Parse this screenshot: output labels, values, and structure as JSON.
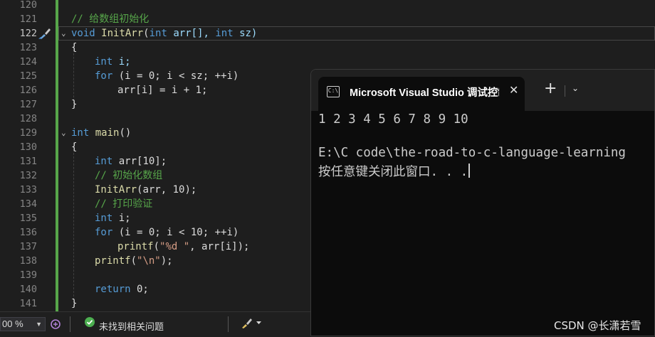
{
  "editor": {
    "line_numbers": [
      "120",
      "121",
      "122",
      "123",
      "124",
      "125",
      "126",
      "127",
      "128",
      "129",
      "130",
      "131",
      "132",
      "133",
      "134",
      "135",
      "136",
      "137",
      "138",
      "139",
      "140",
      "141"
    ],
    "active_line": "122"
  },
  "code": {
    "l121": "// 给数组初始化",
    "l122_kw": "void",
    "l122_fn": "InitArr",
    "l122_p1": "(",
    "l122_kw2": "int",
    "l122_p2": " arr[], ",
    "l122_kw3": "int",
    "l122_p3": " sz)",
    "l123": "{",
    "l124_kw": "int",
    "l124_rest": " i;",
    "l125_kw": "for",
    "l125_rest": " (i = 0; i < sz; ++i)",
    "l126": "arr[i] = i + 1;",
    "l127": "}",
    "l129_kw": "int",
    "l129_fn": "main",
    "l129_rest": "()",
    "l130": "{",
    "l131_kw": "int",
    "l131_rest": " arr[10];",
    "l132": "// 初始化数组",
    "l133_fn": "InitArr",
    "l133_rest": "(arr, 10);",
    "l134": "// 打印验证",
    "l135_kw": "int",
    "l135_rest": " i;",
    "l136_kw": "for",
    "l136_rest": " (i = 0; i < 10; ++i)",
    "l137_fn": "printf",
    "l137_p1": "(",
    "l137_str": "\"%d \"",
    "l137_rest": ", arr[i]);",
    "l138_fn": "printf",
    "l138_p1": "(",
    "l138_str": "\"\\n\"",
    "l138_rest": ");",
    "l140_kw": "return",
    "l140_rest": " 0;",
    "l141": "}"
  },
  "statusbar": {
    "zoom": "00 %",
    "issues": "未找到相关问题"
  },
  "terminal": {
    "tab_title": "Microsoft Visual Studio 调试控制台",
    "close_glyph": "✕",
    "add_glyph": "+",
    "dropdown_glyph": "⌄",
    "output_line1": "1 2 3 4 5 6 7 8 9 10",
    "output_line2": "E:\\C code\\the-road-to-c-language-learning",
    "output_line3": "按任意键关闭此窗口. . ."
  },
  "watermark": "CSDN @长潇若雪",
  "colors": {
    "keyword": "#569cd6",
    "function": "#dcdcaa",
    "comment": "#57a64a",
    "string": "#d69d85",
    "changed_bar": "#57a64a"
  },
  "icons": [
    "brush-icon",
    "fold-chevron-icon",
    "debug-icon",
    "check-circle-icon",
    "brush-dropdown-icon",
    "console-icon",
    "close-icon",
    "add-tab-icon",
    "chevron-down-icon"
  ]
}
